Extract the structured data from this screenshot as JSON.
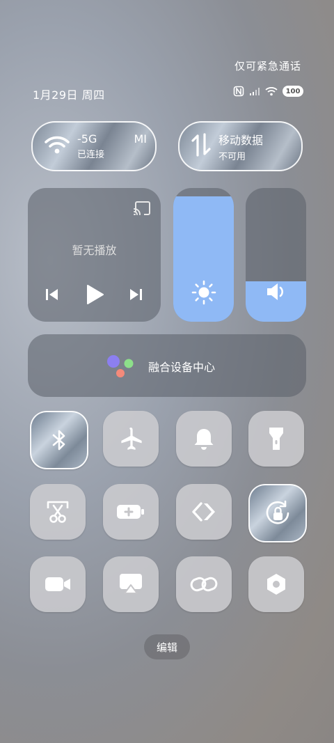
{
  "status": {
    "emergency_text": "仅可紧急通话",
    "date_text": "1月29日 周四",
    "battery_level": "100"
  },
  "network": {
    "wifi_name": "-5G",
    "wifi_name_extra": "MI",
    "wifi_status": "已连接",
    "mobile_title": "移动数据",
    "mobile_status": "不可用"
  },
  "media": {
    "title": "暂无播放"
  },
  "sliders": {
    "brightness_level": 0.94,
    "volume_level": 0.3,
    "accent_color": "#8fb9f5"
  },
  "fusion": {
    "label": "融合设备中心"
  },
  "toggles": [
    {
      "name": "bluetooth",
      "icon": "bluetooth-icon",
      "active": true
    },
    {
      "name": "airplane-mode",
      "icon": "airplane-icon",
      "active": false
    },
    {
      "name": "ringer",
      "icon": "bell-icon",
      "active": false
    },
    {
      "name": "flashlight",
      "icon": "flashlight-icon",
      "active": false
    },
    {
      "name": "screenshot",
      "icon": "scissors-icon",
      "active": false
    },
    {
      "name": "battery-saver",
      "icon": "battery-plus-icon",
      "active": false
    },
    {
      "name": "vpn",
      "icon": "code-brackets-icon",
      "active": false
    },
    {
      "name": "rotation-lock",
      "icon": "rotation-lock-icon",
      "active": true
    },
    {
      "name": "screen-record",
      "icon": "video-camera-icon",
      "active": false
    },
    {
      "name": "screen-cast",
      "icon": "cast-screen-icon",
      "active": false
    },
    {
      "name": "link-share",
      "icon": "link-icon",
      "active": false
    },
    {
      "name": "settings",
      "icon": "hexagon-settings-icon",
      "active": false
    }
  ],
  "footer": {
    "edit_label": "编辑"
  }
}
